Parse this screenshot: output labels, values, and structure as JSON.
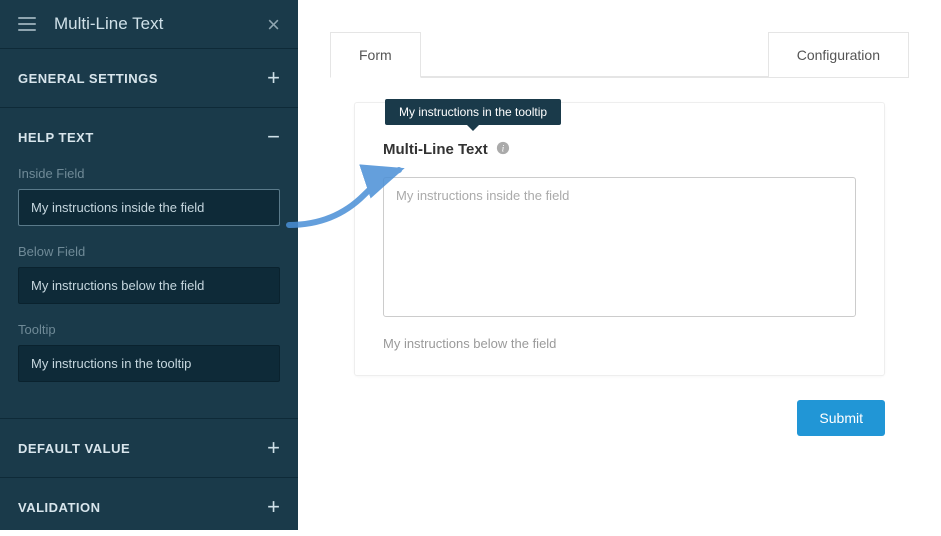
{
  "sidebar": {
    "title": "Multi-Line Text",
    "sections": {
      "general": {
        "title": "GENERAL SETTINGS",
        "toggle": "+"
      },
      "help": {
        "title": "HELP TEXT",
        "toggle": "−",
        "fields": {
          "inside": {
            "label": "Inside Field",
            "value": "My instructions inside the field"
          },
          "below": {
            "label": "Below Field",
            "value": "My instructions below the field"
          },
          "tooltip": {
            "label": "Tooltip",
            "value": "My instructions in the tooltip"
          }
        }
      },
      "default": {
        "title": "DEFAULT VALUE",
        "toggle": "+"
      },
      "validation": {
        "title": "VALIDATION",
        "toggle": "+"
      }
    }
  },
  "main": {
    "tabs": {
      "form": "Form",
      "config": "Configuration"
    },
    "form": {
      "field_label": "Multi-Line Text",
      "tooltip_text": "My instructions in the tooltip",
      "placeholder": "My instructions inside the field",
      "below_text": "My instructions below the field"
    },
    "submit_label": "Submit"
  }
}
